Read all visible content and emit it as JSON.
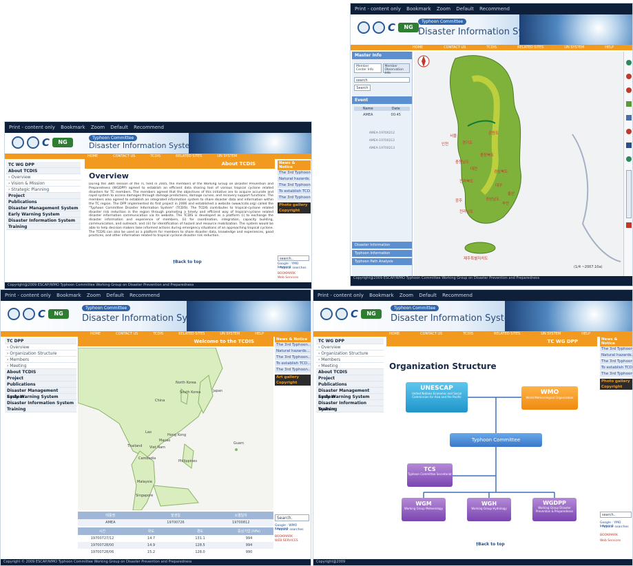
{
  "toolbar": {
    "print": "Print - content only",
    "bookmark": "Bookmark",
    "zoom": "Zoom",
    "default": "Default",
    "recommend": "Recommend"
  },
  "header": {
    "tag": "Typhoon Committee",
    "title": "Disaster Information System",
    "logo_n": "NG"
  },
  "nav": [
    "HOME",
    "CONTACT US",
    "TCDIS",
    "RELATED SITES",
    "UN SYSTEM",
    "HELP"
  ],
  "overview": {
    "banner": "About TCDIS",
    "heading": "Overview",
    "body": "During the 38th session of the TC held in 2005, the members of the Working Group on Disaster Prevention and Preparedness (WGDPP) agreed to establish an efficient data sharing tool of various tropical cyclone related disasters for TC members. The members agreed that the objectives of this initiative are to acquire accurate and rapid system to access damages through damage predictions, damage curves, and recovery support functions. The members also agreed to establish an integrated information system to share disaster data and information within the TC region. The DPP implemented its first project in 2006 and established a website (www.tcdis.org) called the \"Typhoon Committee Disaster Information System\" (TCDIS). The TCDIS contributes to tropical-cyclone related disaster risk reduction in the region through promoting a timely and efficient way of tropical-cyclone related disaster information communication via its website. The TCDIS is developed as a platform (i) to exchange the disaster information and experience of members, (ii) for coordination, integration, capacity building, communication, and outreach, and (iii) for identification of hazard and resource mobilization. The system would be able to help decision makers take informed actions during emergency situations of an approaching tropical cyclone. The TCDIS can also be used as a platform for members to share disaster data, knowledge and experiences, good practices, and other information related to tropical cyclone disaster risk reduction.",
    "back": "†Back to top",
    "sidebar": [
      {
        "label": "TC WG DPP",
        "cls": "b"
      },
      {
        "label": "About TCDIS",
        "cls": "b"
      },
      {
        "label": "› Overview",
        "cls": "s"
      },
      {
        "label": "› Vision & Mission",
        "cls": "s"
      },
      {
        "label": "› Strategic Planning",
        "cls": "s"
      },
      {
        "label": "Project",
        "cls": "b"
      },
      {
        "label": "Publications",
        "cls": "b"
      },
      {
        "label": "Disaster Management System",
        "cls": "b"
      },
      {
        "label": "Early Warning System",
        "cls": "b"
      },
      {
        "label": "Disaster Information System",
        "cls": "b"
      },
      {
        "label": "Training",
        "cls": "b"
      }
    ],
    "footer": "Copyright@2009  ESCAP/WMO Typhoon Committee Working Group on Disaster Prevention and Preparedness"
  },
  "mapview": {
    "master": "Master Info",
    "tabs": [
      "Member Center Info",
      "Member Observation Info"
    ],
    "search_label": "search",
    "search_button": "Search",
    "list_header": "Event",
    "cols": [
      "Name",
      "Date"
    ],
    "rows": [
      [
        "AMEA",
        "00:45"
      ],
      [
        "AMEA-19700212",
        ""
      ],
      [
        "AMEA-19700212",
        ""
      ],
      [
        "AMEA-19700213",
        ""
      ]
    ],
    "sections": [
      "Disaster Information",
      "Typhoon Information",
      "Typhoon Path Analysis"
    ],
    "footer": "Copyright@2009  ESCAP/WMO Typhoon Committee Working Group on Disaster Prevention and Preparedness",
    "scale": "(1/4 ~2007.10a)"
  },
  "welcome": {
    "banner": "Welcome to the TCDIS",
    "sidebar": [
      {
        "label": "TC DPP",
        "cls": "b"
      },
      {
        "label": "› Overview",
        "cls": "s"
      },
      {
        "label": "› Organization Structure",
        "cls": "s"
      },
      {
        "label": "› Members",
        "cls": "s"
      },
      {
        "label": "› Meeting",
        "cls": "s"
      },
      {
        "label": "About TCDIS",
        "cls": "b"
      },
      {
        "label": "Project",
        "cls": "b"
      },
      {
        "label": "Publications",
        "cls": "b"
      },
      {
        "label": "Disaster Management System",
        "cls": "b"
      },
      {
        "label": "Early Warning System",
        "cls": "b"
      },
      {
        "label": "Disaster Information System",
        "cls": "b"
      },
      {
        "label": "Training",
        "cls": "b"
      }
    ],
    "map_labels": [
      "China",
      "North Korea",
      "South Korea",
      "Japan",
      "Hong Kong",
      "Macao",
      "Lao",
      "Thailand",
      "Viet Nam",
      "Cambodia",
      "Philippines",
      "Malaysia",
      "Singapore",
      "Guam"
    ],
    "table_head1": [
      "태풍명",
      "발생일",
      "소멸일자"
    ],
    "table_row1": [
      "AMEA",
      "19700726",
      "19700812"
    ],
    "table_head2": [
      "시간",
      "위도",
      "경도",
      "중심기압 (hPa)"
    ],
    "table_rows": [
      [
        "19700727/12",
        "14.7",
        "131.1",
        "994"
      ],
      [
        "19700728/00",
        "14.9",
        "128.5",
        "994"
      ],
      [
        "19700728/06",
        "15.2",
        "128.0",
        "990"
      ]
    ],
    "search": "Search.",
    "google": "Google : WMO Keyword",
    "popular": "› Popular searches",
    "bookmark": "BOOKMARK",
    "web": "WEB SERVICES",
    "footer": "Copyright © 2009  ESCAP/WMO Typhoon Committee Working Group on Disaster Prevention and Preparedness"
  },
  "org": {
    "banner": "TC WG DPP",
    "heading": "Organization Structure",
    "sidebar": [
      {
        "label": "TC WG DPP",
        "cls": "b"
      },
      {
        "label": "› Overview",
        "cls": "s"
      },
      {
        "label": "› Organization Structure",
        "cls": "s"
      },
      {
        "label": "› Members",
        "cls": "s"
      },
      {
        "label": "› Meeting",
        "cls": "s"
      },
      {
        "label": "About TCDIS",
        "cls": "b"
      },
      {
        "label": "Project",
        "cls": "b"
      },
      {
        "label": "Publications",
        "cls": "b"
      },
      {
        "label": "Disaster Management System",
        "cls": "b"
      },
      {
        "label": "Early Warning System",
        "cls": "b"
      },
      {
        "label": "Disaster Information System",
        "cls": "b"
      },
      {
        "label": "Training",
        "cls": "b"
      }
    ],
    "nodes": {
      "unescap": {
        "t": "UNESCAP",
        "s": "United Nations Economic and Social Commission for Asia and the Pacific"
      },
      "wmo": {
        "t": "WMO",
        "s": "World Meteorological Organization"
      },
      "tc": {
        "t": "Typhoon Committee",
        "s": ""
      },
      "tcs": {
        "t": "TCS",
        "s": "Typhoon Committee Secretariat"
      },
      "wgm": {
        "t": "WGM",
        "s": "Working Group Meteorology"
      },
      "wgh": {
        "t": "WGH",
        "s": "Working Group Hydrology"
      },
      "wgdpp": {
        "t": "WGDPP",
        "s": "Working Group Disaster Prevention & Preparedness"
      }
    },
    "back": "†Back to top",
    "search": "search..",
    "google": "Google : YMO keyword",
    "popular": "› Popular searches",
    "bookmark": "BOOKMARK",
    "web": "Web Services",
    "footer": "Copyright@2009"
  },
  "rightpanel": {
    "notice": "News & Notice",
    "news": [
      "The 3rd Typhoon...",
      "Natural hazards...",
      "The 3rd Typhoon...",
      "To establish TCD...",
      "The 3rd Typhoon..."
    ],
    "gallery": "Photo gallery",
    "copyright": "Copyright",
    "art": "Art gallery"
  },
  "korea_labels": [
    "서울",
    "인천",
    "경기도",
    "강원도",
    "충청북도",
    "충청남도",
    "대전",
    "전라북도",
    "경상북도",
    "대구",
    "울산",
    "부산",
    "광주",
    "전라남도",
    "경상남도",
    "제주특별자치도"
  ]
}
